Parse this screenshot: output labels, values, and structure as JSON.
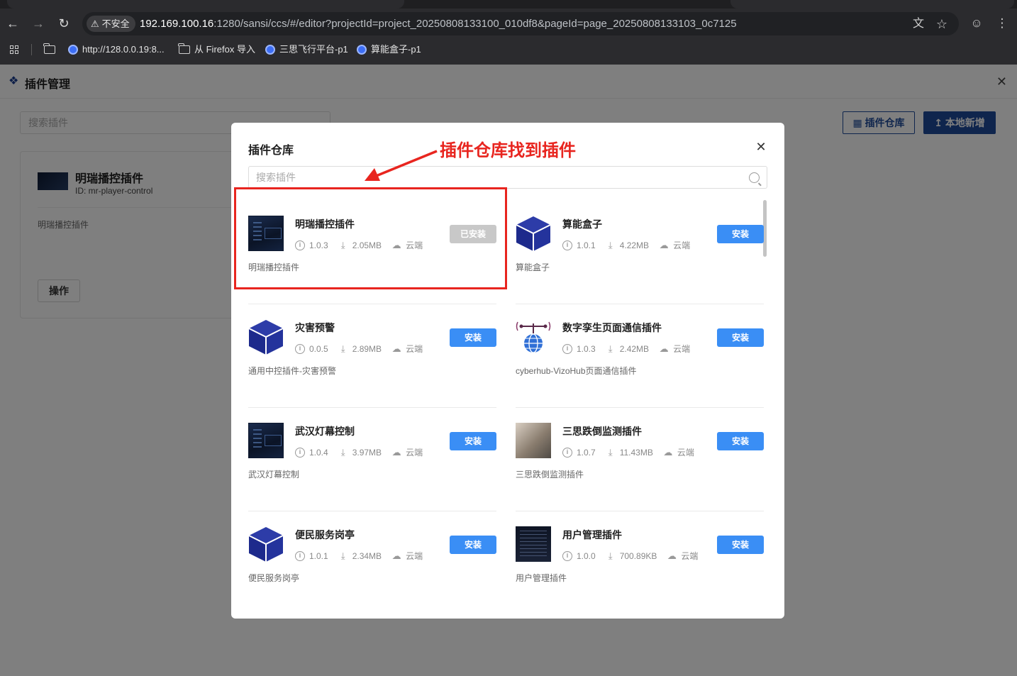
{
  "browser": {
    "insecure_label": "不安全",
    "url_host": "192.169.100.16",
    "url_rest": ":1280/sansi/ccs/#/editor?projectId=project_20250808133100_010df8&pageId=page_20250808133103_0c7125",
    "bookmarks": [
      {
        "label": "http://128.0.0.19:8..."
      },
      {
        "label": "从 Firefox 导入"
      },
      {
        "label": "三思飞行平台-p1"
      },
      {
        "label": "算能盒子-p1"
      }
    ]
  },
  "page": {
    "title": "插件管理",
    "search_placeholder": "搜索插件",
    "store_button": "插件仓库",
    "local_add_button": "本地新增",
    "installed": {
      "name": "明瑞播控插件",
      "id_text": "ID: mr-player-control",
      "description": "明瑞播控插件",
      "operate_button": "操作"
    }
  },
  "modal": {
    "title": "插件仓库",
    "search_placeholder": "搜索插件",
    "plugins": [
      {
        "name": "明瑞播控插件",
        "version": "1.0.3",
        "size": "2.05MB",
        "source": "云端",
        "description": "明瑞播控插件",
        "button": "已安装",
        "installed": true,
        "thumb": "dark-screen"
      },
      {
        "name": "算能盒子",
        "version": "1.0.1",
        "size": "4.22MB",
        "source": "云端",
        "description": "算能盒子",
        "button": "安装",
        "installed": false,
        "thumb": "cube"
      },
      {
        "name": "灾害预警",
        "version": "0.0.5",
        "size": "2.89MB",
        "source": "云端",
        "description": "通用中控插件-灾害预警",
        "button": "安装",
        "installed": false,
        "thumb": "cube"
      },
      {
        "name": "数字孪生页面通信插件",
        "version": "1.0.3",
        "size": "2.42MB",
        "source": "云端",
        "description": "cyberhub-VizoHub页面通信插件",
        "button": "安装",
        "installed": false,
        "thumb": "globe-antenna"
      },
      {
        "name": "武汉灯幕控制",
        "version": "1.0.4",
        "size": "3.97MB",
        "source": "云端",
        "description": "武汉灯幕控制",
        "button": "安装",
        "installed": false,
        "thumb": "dark-screen"
      },
      {
        "name": "三思跌倒监测插件",
        "version": "1.0.7",
        "size": "11.43MB",
        "source": "云端",
        "description": "三思跌倒监测插件",
        "button": "安装",
        "installed": false,
        "thumb": "photo"
      },
      {
        "name": "便民服务岗亭",
        "version": "1.0.1",
        "size": "2.34MB",
        "source": "云端",
        "description": "便民服务岗亭",
        "button": "安装",
        "installed": false,
        "thumb": "cube"
      },
      {
        "name": "用户管理插件",
        "version": "1.0.0",
        "size": "700.89KB",
        "source": "云端",
        "description": "用户管理插件",
        "button": "安装",
        "installed": false,
        "thumb": "dark-list"
      }
    ]
  },
  "annotation": {
    "text": "插件仓库找到插件",
    "color": "#e8251f"
  },
  "colors": {
    "primary": "#1e4b9a",
    "install_button": "#3a8ef5",
    "installed_button": "#c8c8c8"
  }
}
